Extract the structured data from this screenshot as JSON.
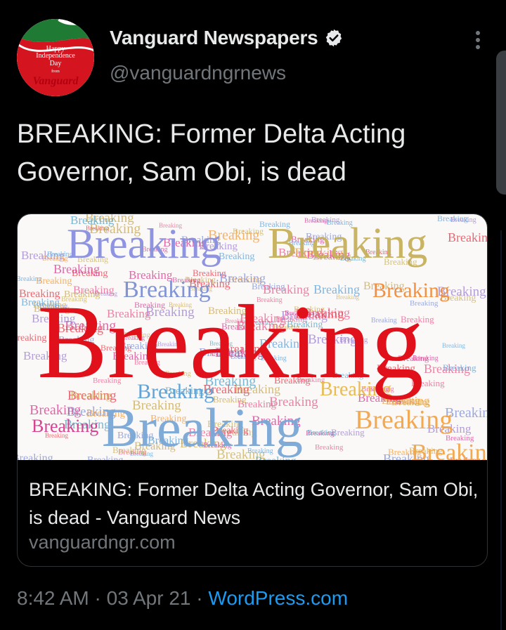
{
  "account": {
    "display_name": "Vanguard Newspapers",
    "handle": "@vanguardngrnews",
    "avatar_text": [
      "Happy",
      "Independence",
      "Day",
      "from",
      "Vanguard"
    ]
  },
  "tweet": {
    "text": "BREAKING: Former Delta Acting Governor, Sam Obi, is dead"
  },
  "card": {
    "image_word": "Breaking",
    "title": "BREAKING: Former Delta Acting Governor, Sam Obi, is dead - Vanguard News",
    "domain": "vanguardngr.com"
  },
  "meta": {
    "time": "8:42 AM",
    "separator": "·",
    "date": "03 Apr 21",
    "source": "WordPress.com"
  },
  "colors": {
    "background": "#000000",
    "text_primary": "#e7e9ea",
    "text_secondary": "#71767b",
    "link": "#1d9bf0",
    "breaking_red": "#e0111b"
  },
  "icons": [
    "verified-badge-icon",
    "more-options-icon"
  ]
}
